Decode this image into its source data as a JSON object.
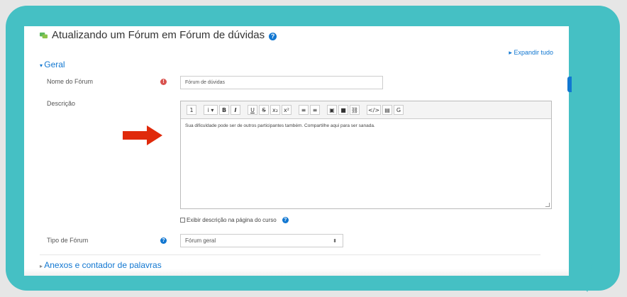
{
  "page": {
    "title": "Atualizando um Fórum em Fórum de dúvidas",
    "help_icon": "question-icon",
    "expand_all": "Expandir tudo"
  },
  "geral": {
    "section_label": "Geral",
    "forum_name_label": "Nome do Fórum",
    "forum_name_value": "Fórum de dúvidas",
    "description_label": "Descrição",
    "description_text": "Sua dificuldade pode ser de outros participantes também. Compartilhe aqui para ser sanada.",
    "display_description_label": "Exibir descrição na página do curso",
    "forum_type_label": "Tipo de Fórum",
    "forum_type_value": "Fórum geral"
  },
  "toolbar": {
    "buttons": [
      "1",
      "i ▾",
      "B",
      "I",
      "U",
      "S",
      "x₂",
      "x²",
      "≡",
      "≡",
      "▣",
      "■",
      "⛓",
      "</>",
      "▤",
      "G"
    ]
  },
  "anexos": {
    "section_label": "Anexos e contador de palavras"
  },
  "colors": {
    "bubble": "#45c0c4",
    "link": "#1177d1",
    "required": "#d9534f",
    "arrow": "#e02a0b"
  }
}
